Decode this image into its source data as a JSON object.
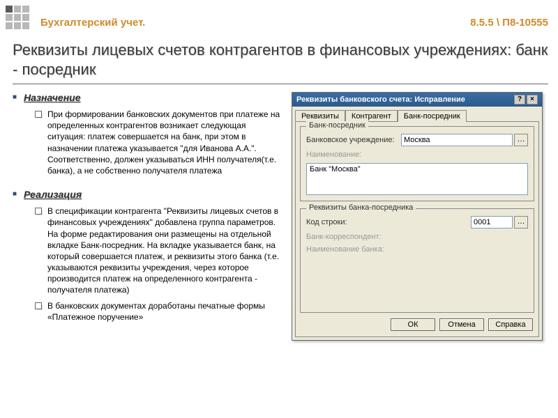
{
  "header": {
    "left": "Бухгалтерский учет.",
    "right": "8.5.5 \\ П8-10555"
  },
  "title": "Реквизиты лицевых счетов контрагентов в финансовых учреждениях: банк - посредник",
  "sections": {
    "purpose": {
      "heading": "Назначение",
      "text": "При формировании банковских документов при платеже на определенных контрагентов возникает следующая ситуация: платеж совершается на банк, при этом в назначении платежа указывается \"для Иванова А.А.\". Соответственно, должен указываться ИНН получателя(т.е. банка), а не собственно получателя платежа"
    },
    "realization": {
      "heading": "Реализация",
      "items": [
        "В спецификации контрагента \"Реквизиты лицевых счетов в финансовых учреждениях\" добавлена группа параметров. На форме редактирования они размещены на отдельной вкладке Банк-посредник. На вкладке указывается банк, на который совершается платеж, и реквизиты этого банка (т.е. указываются реквизиты учреждения, через которое производится платеж на определенного контрагента - получателя платежа)",
        "В банковских документах доработаны печатные формы «Платежное поручение»"
      ]
    }
  },
  "dialog": {
    "title": "Реквизиты банковского счета: Исправление",
    "help_btn": "?",
    "close_btn": "×",
    "tabs": [
      "Реквизиты",
      "Контрагент",
      "Банк-посредник"
    ],
    "active_tab": "Банк-посредник",
    "group1": {
      "legend": "Банк-посредник",
      "bank_label": "Банковское учреждение:",
      "bank_value": "Москва",
      "name_label": "Наименование:",
      "name_value": "Банк \"Москва\""
    },
    "group2": {
      "legend": "Реквизиты банка-посредника",
      "row_label": "Код строки:",
      "row_value": "0001",
      "corr_label": "Банк-корреспондент:",
      "corr_name_label": "Наименование банка:"
    },
    "buttons": {
      "ok": "ОК",
      "cancel": "Отмена",
      "help": "Справка"
    }
  }
}
